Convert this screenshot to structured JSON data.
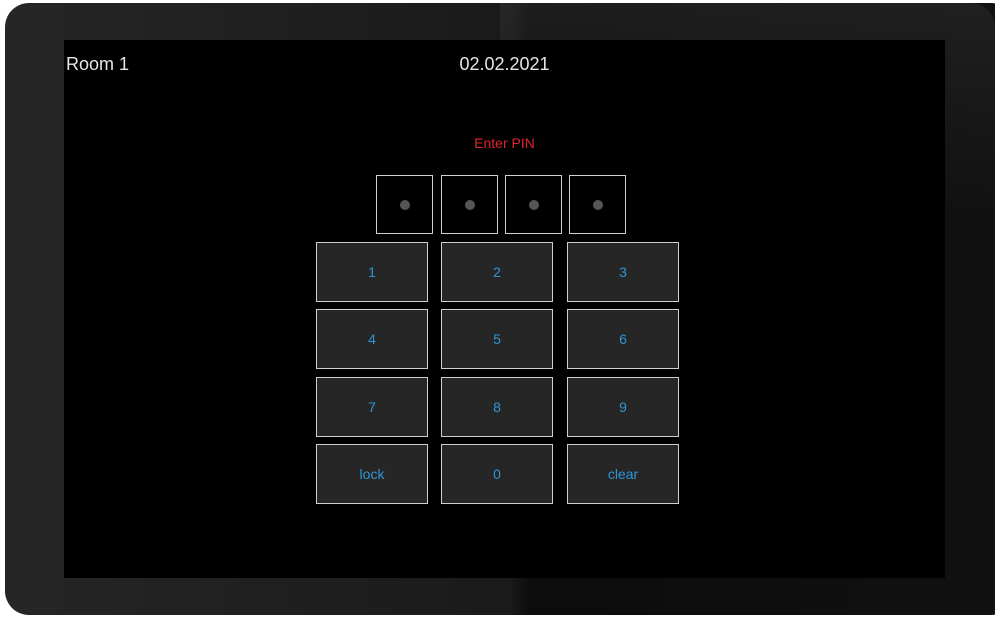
{
  "header": {
    "room_name": "Room 1",
    "date": "02.02.2021"
  },
  "pin": {
    "prompt": "Enter PIN",
    "digits_total": 4,
    "digits_entered": 0
  },
  "keypad": {
    "keys": [
      "1",
      "2",
      "3",
      "4",
      "5",
      "6",
      "7",
      "8",
      "9",
      "lock",
      "0",
      "clear"
    ]
  },
  "colors": {
    "prompt": "#e0242b",
    "key_text": "#2f96d6",
    "key_background": "#262626",
    "screen_background": "#000000"
  }
}
